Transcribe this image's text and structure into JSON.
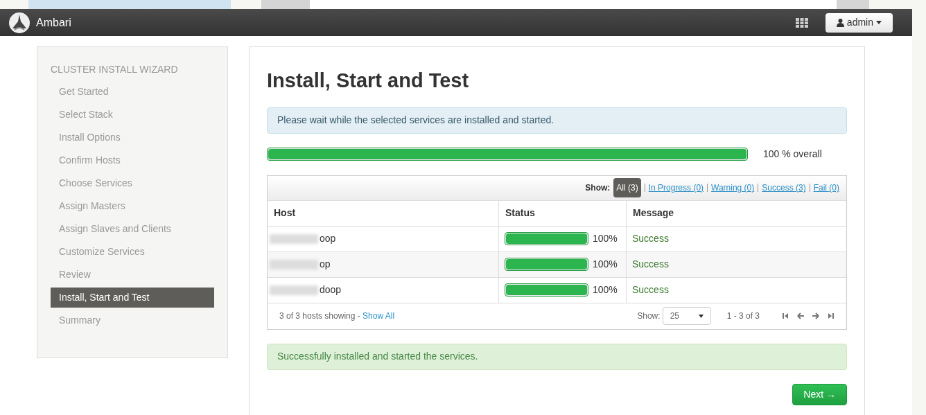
{
  "navbar": {
    "brand": "Ambari",
    "user_menu": {
      "label": "admin"
    }
  },
  "sidebar": {
    "title": "CLUSTER INSTALL WIZARD",
    "items": [
      {
        "label": "Get Started",
        "selected": false
      },
      {
        "label": "Select Stack",
        "selected": false
      },
      {
        "label": "Install Options",
        "selected": false
      },
      {
        "label": "Confirm Hosts",
        "selected": false
      },
      {
        "label": "Choose Services",
        "selected": false
      },
      {
        "label": "Assign Masters",
        "selected": false
      },
      {
        "label": "Assign Slaves and Clients",
        "selected": false
      },
      {
        "label": "Customize Services",
        "selected": false
      },
      {
        "label": "Review",
        "selected": false
      },
      {
        "label": "Install, Start and Test",
        "selected": true
      },
      {
        "label": "Summary",
        "selected": false
      }
    ]
  },
  "main": {
    "title": "Install, Start and Test",
    "info_alert": "Please wait while the selected services are installed and started.",
    "overall_progress": {
      "level": 1,
      "reading": "100 % overall"
    },
    "filter": {
      "label": "Show:",
      "options": [
        {
          "label": "All (3)",
          "selected": true
        },
        {
          "label": "In Progress (0)",
          "selected": false
        },
        {
          "label": "Warning (0)",
          "selected": false
        },
        {
          "label": "Success (3)",
          "selected": false
        },
        {
          "label": "Fail (0)",
          "selected": false
        }
      ]
    },
    "table": {
      "columns": [
        "Host",
        "Status",
        "Message"
      ],
      "rows": [
        {
          "host": "oop",
          "level": 1,
          "reading": "100%",
          "message": "Success"
        },
        {
          "host": "op",
          "level": 1,
          "reading": "100%",
          "message": "Success"
        },
        {
          "host": "doop",
          "level": 1,
          "reading": "100%",
          "message": "Success"
        }
      ]
    },
    "footer": {
      "summary": "3 of 3 hosts showing - ",
      "show_all": "Show All",
      "show_label": "Show:",
      "page_size": "25",
      "range": "1 - 3 of 3"
    },
    "success_alert": "Successfully installed and started the services.",
    "next_button": "Next →"
  }
}
